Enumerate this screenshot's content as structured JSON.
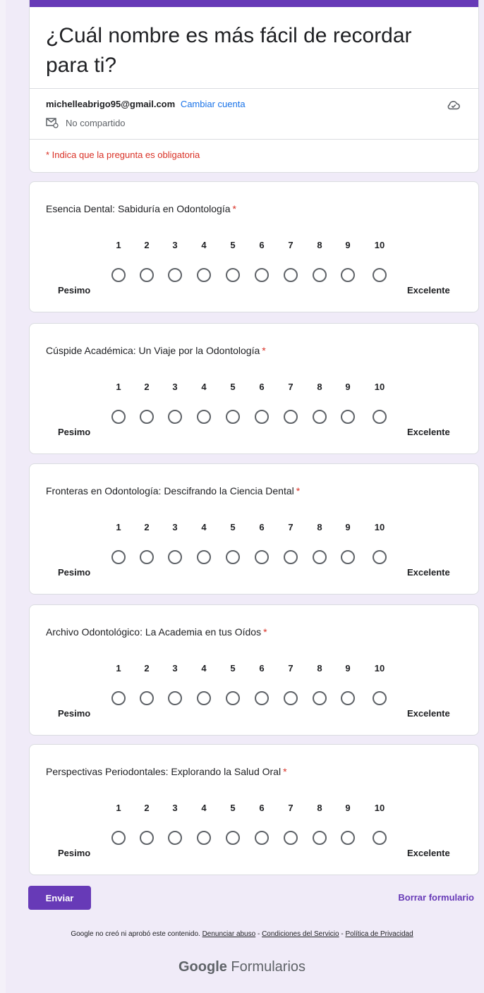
{
  "form": {
    "title": "¿Cuál nombre es más fácil de recordar para ti?",
    "account_email": "michelleabrigo95@gmail.com",
    "switch_account": "Cambiar cuenta",
    "not_shared": "No compartido",
    "required_note": "* Indica que la pregunta es obligatoria",
    "accent_color": "#673ab7"
  },
  "scale": {
    "numbers": [
      "1",
      "2",
      "3",
      "4",
      "5",
      "6",
      "7",
      "8",
      "9",
      "10"
    ],
    "low_label": "Pesimo",
    "high_label": "Excelente"
  },
  "questions": [
    {
      "title": "Esencia Dental: Sabiduría en Odontología",
      "required": "*"
    },
    {
      "title": "Cúspide Académica: Un Viaje por la Odontología",
      "required": "*"
    },
    {
      "title": "Fronteras en Odontología: Descifrando la Ciencia Dental",
      "required": "*"
    },
    {
      "title": "Archivo Odontológico: La Academia en tus Oídos",
      "required": "*"
    },
    {
      "title": "Perspectivas Periodontales: Explorando la Salud Oral",
      "required": "*"
    }
  ],
  "actions": {
    "submit": "Enviar",
    "clear": "Borrar formulario"
  },
  "footer": {
    "disclaimer": "Google no creó ni aprobó este contenido.",
    "report_abuse": "Denunciar abuso",
    "terms": "Condiciones del Servicio",
    "privacy": "Política de Privacidad",
    "sep": " - ",
    "brand_bold": "Google",
    "brand_rest": " Formularios"
  }
}
